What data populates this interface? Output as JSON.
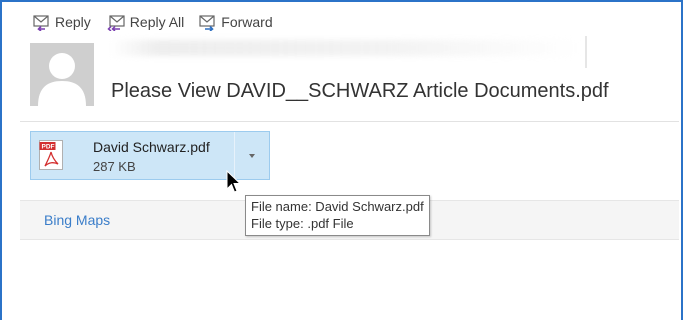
{
  "toolbar": {
    "reply_label": "Reply",
    "reply_all_label": "Reply All",
    "forward_label": "Forward"
  },
  "message": {
    "subject": "Please View DAVID__SCHWARZ Article Documents.pdf"
  },
  "attachment": {
    "name": "David Schwarz.pdf",
    "size": "287 KB",
    "icon": "pdf-icon",
    "dropdown_icon": "chevron-down-icon"
  },
  "tooltip": {
    "name_line": "File name:  David Schwarz.pdf",
    "type_line": "File type:  .pdf File"
  },
  "addins": {
    "bing_maps": "Bing Maps"
  },
  "colors": {
    "frame_border": "#2b73c8",
    "attachment_bg": "#cde6f7",
    "link": "#3a7dc9"
  }
}
